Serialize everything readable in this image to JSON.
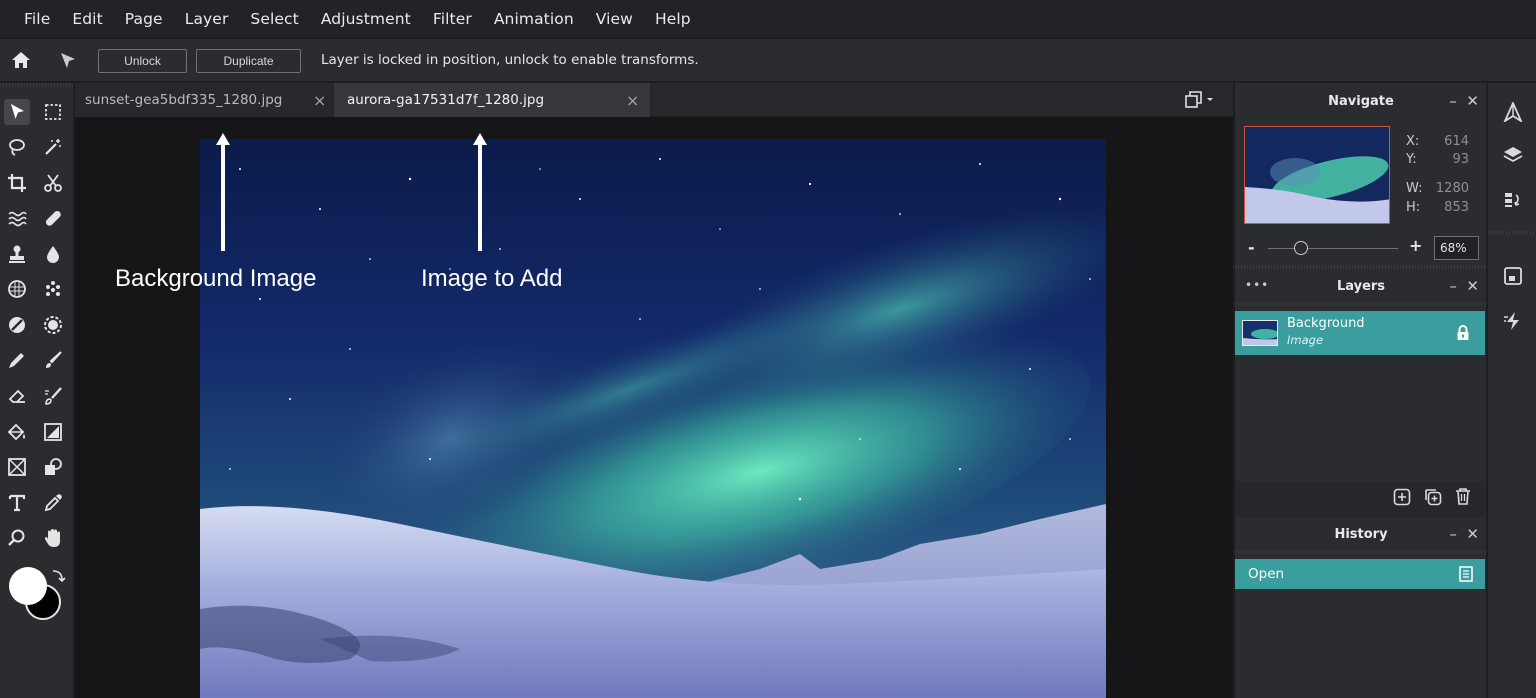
{
  "menu": [
    "File",
    "Edit",
    "Page",
    "Layer",
    "Select",
    "Adjustment",
    "Filter",
    "Animation",
    "View",
    "Help"
  ],
  "toolbar": {
    "unlock_label": "Unlock",
    "duplicate_label": "Duplicate",
    "message": "Layer is locked in position, unlock to enable transforms."
  },
  "tabs": [
    {
      "label": "sunset-gea5bdf335_1280.jpg",
      "close": "×",
      "active": false
    },
    {
      "label": "aurora-ga17531d7f_1280.jpg",
      "close": "×",
      "active": true
    }
  ],
  "annotations": {
    "background_image": "Background Image",
    "image_to_add": "Image to Add"
  },
  "navigate": {
    "title": "Navigate",
    "x_label": "X:",
    "x_value": "614",
    "y_label": "Y:",
    "y_value": "93",
    "w_label": "W:",
    "w_value": "1280",
    "h_label": "H:",
    "h_value": "853",
    "zoom_minus": "-",
    "zoom_plus": "+",
    "zoom_value": "68%",
    "zoom_slider_fraction": 0.25
  },
  "layers": {
    "title": "Layers",
    "dots": "•••",
    "items": [
      {
        "name": "Background",
        "type": "Image",
        "locked": true
      }
    ]
  },
  "history": {
    "title": "History",
    "items": [
      "Open"
    ]
  },
  "panel_controls": {
    "minimize": "–",
    "close": "✕"
  },
  "colors": {
    "accent": "#3aa0a0",
    "menubar": "#222326",
    "panel": "#2b2c30",
    "canvas_bg": "#161618",
    "primary_color": "#ffffff",
    "secondary_color": "#000000"
  },
  "icons": {
    "home": "home-icon",
    "pointer": "pointer-icon",
    "layout": "layout-icon"
  }
}
